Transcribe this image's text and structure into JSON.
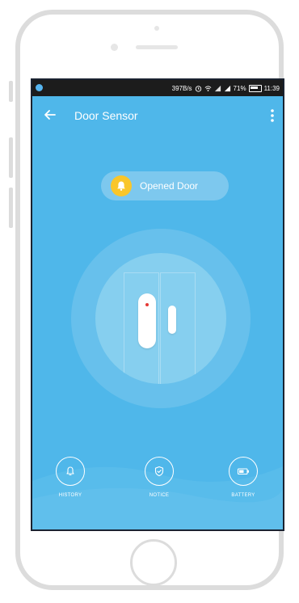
{
  "statusbar": {
    "speed": "397B/s",
    "battery_percent": "71%",
    "time": "11:39"
  },
  "appbar": {
    "title": "Door Sensor",
    "back_icon": "arrow-left-icon",
    "more_icon": "more-vert-icon"
  },
  "status": {
    "label": "Opened Door",
    "icon": "bell-icon",
    "color": "#f9c62a"
  },
  "nav": {
    "history": {
      "label": "HISTORY",
      "icon": "bell-icon"
    },
    "notice": {
      "label": "NOTICE",
      "icon": "shield-icon"
    },
    "battery": {
      "label": "BATTERY",
      "icon": "battery-icon"
    }
  },
  "colors": {
    "screen_bg": "#4fb7ea",
    "accent": "#f9c62a",
    "led": "#e53935"
  }
}
